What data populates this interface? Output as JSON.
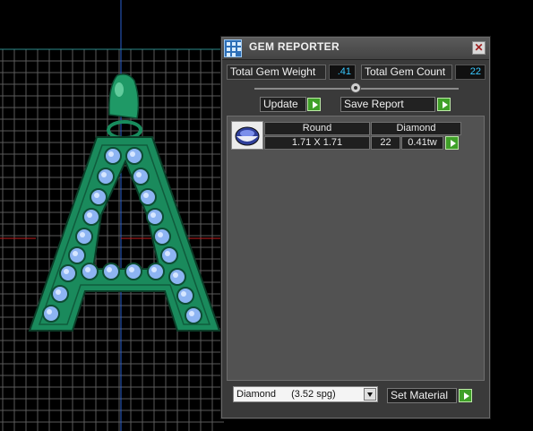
{
  "window": {
    "title": "GEM REPORTER",
    "close_symbol": "✕"
  },
  "summary": {
    "total_weight_label": "Total Gem Weight",
    "total_weight_value": ".41",
    "total_count_label": "Total Gem Count",
    "total_count_value": "22"
  },
  "toolbar": {
    "update_label": "Update",
    "save_report_label": "Save Report"
  },
  "gem_table": {
    "rows": [
      {
        "shape": "Round",
        "material": "Diamond",
        "size": "1.71 X 1.71",
        "count": "22",
        "weight": "0.41tw"
      }
    ]
  },
  "material": {
    "selected_name": "Diamond",
    "selected_gravity": "(3.52 spg)",
    "set_material_label": "Set Material"
  },
  "colors": {
    "background": "#000000",
    "grid": "#5a5a5a",
    "pendant_green": "#1a8a5c",
    "gem_blue": "#8db4f2",
    "value_text": "#38c8ff",
    "go_button": "#3fa028"
  },
  "icons": [
    "app-icon",
    "close-icon",
    "slider-thumb-icon",
    "go-arrow-icon",
    "gem-shape-icon",
    "dropdown-arrow-icon"
  ]
}
